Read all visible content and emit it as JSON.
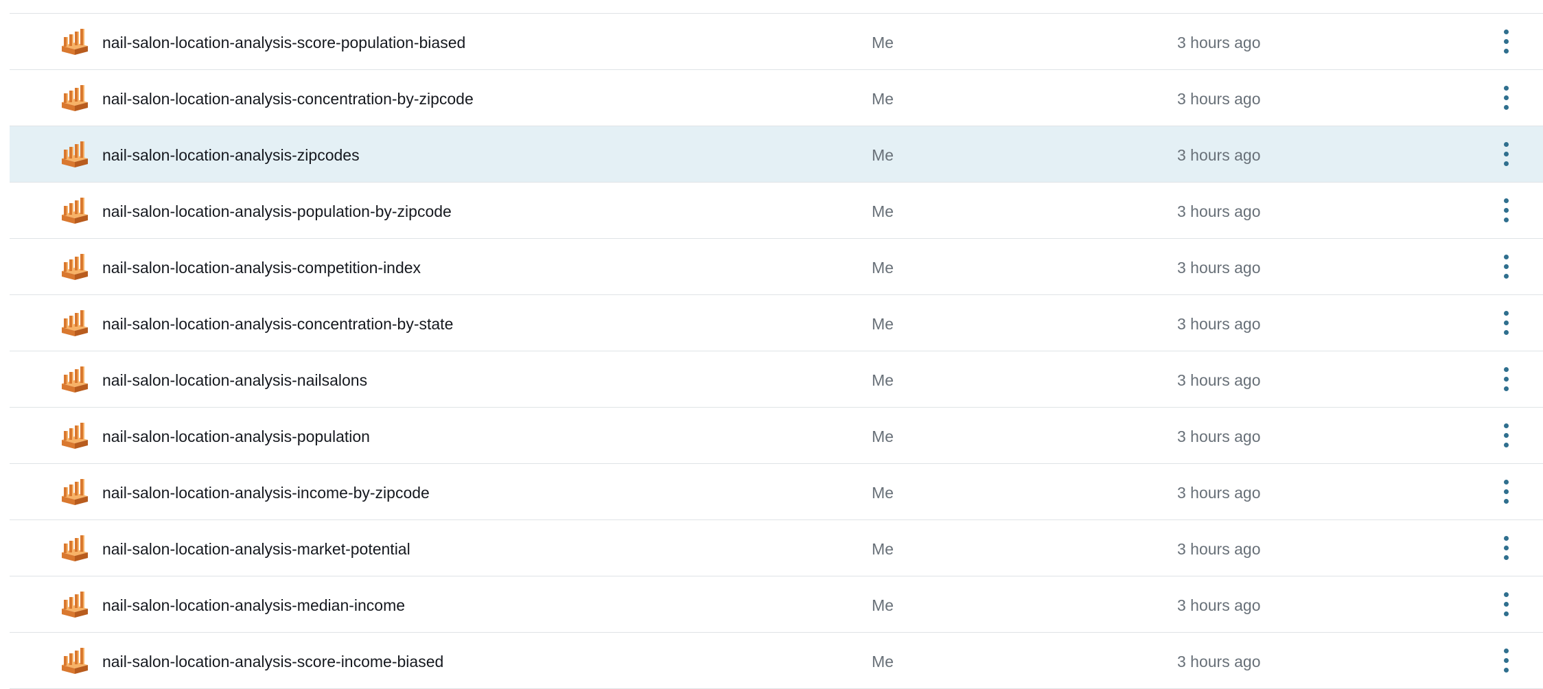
{
  "accent_color": "#2f6f8e",
  "selected_row_color": "#e4f0f5",
  "icon": {
    "name": "dataset-icon",
    "colors": [
      "#f7b267",
      "#d9782f",
      "#b85c1e"
    ]
  },
  "rows": [
    {
      "name": "nail-salon-location-analysis-score-population-biased",
      "owner": "Me",
      "modified": "3 hours ago",
      "selected": false
    },
    {
      "name": "nail-salon-location-analysis-concentration-by-zipcode",
      "owner": "Me",
      "modified": "3 hours ago",
      "selected": false
    },
    {
      "name": "nail-salon-location-analysis-zipcodes",
      "owner": "Me",
      "modified": "3 hours ago",
      "selected": true
    },
    {
      "name": "nail-salon-location-analysis-population-by-zipcode",
      "owner": "Me",
      "modified": "3 hours ago",
      "selected": false
    },
    {
      "name": "nail-salon-location-analysis-competition-index",
      "owner": "Me",
      "modified": "3 hours ago",
      "selected": false
    },
    {
      "name": "nail-salon-location-analysis-concentration-by-state",
      "owner": "Me",
      "modified": "3 hours ago",
      "selected": false
    },
    {
      "name": "nail-salon-location-analysis-nailsalons",
      "owner": "Me",
      "modified": "3 hours ago",
      "selected": false
    },
    {
      "name": "nail-salon-location-analysis-population",
      "owner": "Me",
      "modified": "3 hours ago",
      "selected": false
    },
    {
      "name": "nail-salon-location-analysis-income-by-zipcode",
      "owner": "Me",
      "modified": "3 hours ago",
      "selected": false
    },
    {
      "name": "nail-salon-location-analysis-market-potential",
      "owner": "Me",
      "modified": "3 hours ago",
      "selected": false
    },
    {
      "name": "nail-salon-location-analysis-median-income",
      "owner": "Me",
      "modified": "3 hours ago",
      "selected": false
    },
    {
      "name": "nail-salon-location-analysis-score-income-biased",
      "owner": "Me",
      "modified": "3 hours ago",
      "selected": false
    }
  ]
}
